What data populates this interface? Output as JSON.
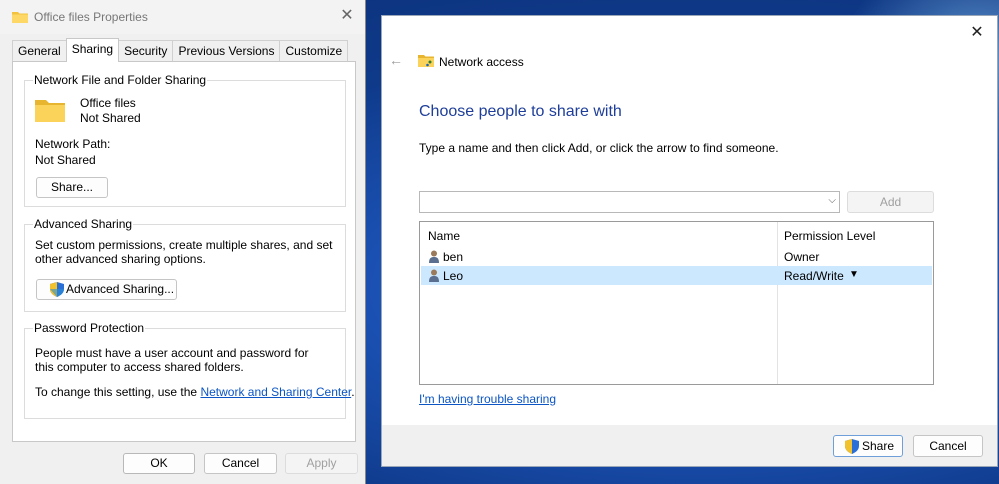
{
  "properties": {
    "title": "Office files Properties",
    "tabs": [
      "General",
      "Sharing",
      "Security",
      "Previous Versions",
      "Customize"
    ],
    "active_tab": "Sharing",
    "network_sharing": {
      "group_title": "Network File and Folder Sharing",
      "folder_name": "Office files",
      "folder_status": "Not Shared",
      "network_path_label": "Network Path:",
      "network_path_value": "Not Shared",
      "share_button": "Share..."
    },
    "advanced_sharing": {
      "group_title": "Advanced Sharing",
      "description": "Set custom permissions, create multiple shares, and set other advanced sharing options.",
      "button": "Advanced Sharing..."
    },
    "password_protection": {
      "group_title": "Password Protection",
      "description": "People must have a user account and password for this computer to access shared folders.",
      "change_prefix": "To change this setting, use the ",
      "change_link": "Network and Sharing Center",
      "change_suffix": "."
    },
    "buttons": {
      "ok": "OK",
      "cancel": "Cancel",
      "apply": "Apply"
    }
  },
  "network_access": {
    "window_title": "Network access",
    "heading": "Choose people to share with",
    "instruction": "Type a name and then click Add, or click the arrow to find someone.",
    "name_input_value": "",
    "add_button": "Add",
    "columns": {
      "name": "Name",
      "permission": "Permission Level"
    },
    "rows": [
      {
        "name": "ben",
        "permission": "Owner"
      },
      {
        "name": "Leo",
        "permission": "Read/Write"
      }
    ],
    "trouble_link": "I'm having trouble sharing",
    "share_button": "Share",
    "cancel_button": "Cancel"
  },
  "icons": [
    "folder-icon",
    "close-icon",
    "back-arrow-icon",
    "shared-folder-icon",
    "user-icon",
    "shield-icon",
    "dropdown-arrow-icon"
  ],
  "colors": {
    "heading_blue": "#1e3e9a",
    "link_blue": "#0b55c4",
    "selected_row": "#cce8ff"
  }
}
